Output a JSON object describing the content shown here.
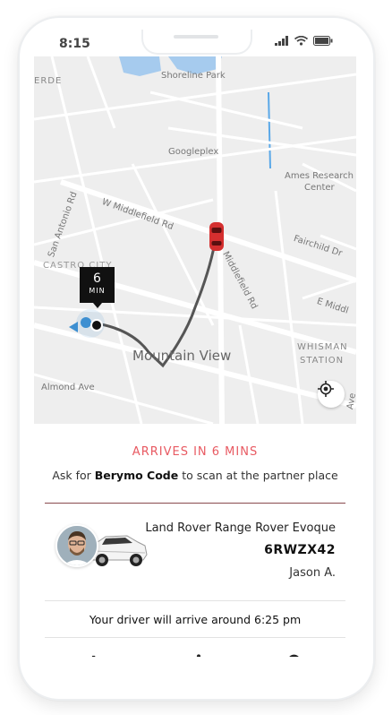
{
  "status_bar": {
    "time": "8:15"
  },
  "map": {
    "labels": {
      "erde": "ERDE",
      "shoreline_park": "Shoreline Park",
      "googleplex": "Googleplex",
      "ames_research": "Ames Research",
      "center": "Center",
      "san_antonio_rd": "San Antonio Rd",
      "w_middlefield_rd": "W Middlefield Rd",
      "middlefield_rd": "Middlefield Rd",
      "fairchild_dr": "Fairchild Dr",
      "castro_city": "CASTRO CITY",
      "e_middle": "E Middl",
      "mountain_view": "Mountain View",
      "whisman": "WHISMAN",
      "station": "STATION",
      "almond_ave": "Almond Ave",
      "ave": "Ave"
    },
    "eta_badge": {
      "number": "6",
      "unit": "MIN"
    },
    "colors": {
      "route": "#555555",
      "car": "#d42f2f",
      "user_dot": "#3d8fd1",
      "water": "#a6cbee"
    }
  },
  "trip": {
    "arrives_title": "ARRIVES IN 6 MINS",
    "ask_prefix": "Ask for ",
    "ask_code": "Berymo Code",
    "ask_suffix": " to scan at the partner place",
    "accent_color": "#e85a62"
  },
  "driver": {
    "car_model": "Land Rover Range Rover Evoque",
    "plate": "6RWZX42",
    "name": "Jason A."
  },
  "arrival_text": "Your driver will arrive around 6:25 pm",
  "actions": [
    {
      "icon": "phone-icon"
    },
    {
      "icon": "share-icon"
    },
    {
      "icon": "cancel-icon"
    }
  ]
}
